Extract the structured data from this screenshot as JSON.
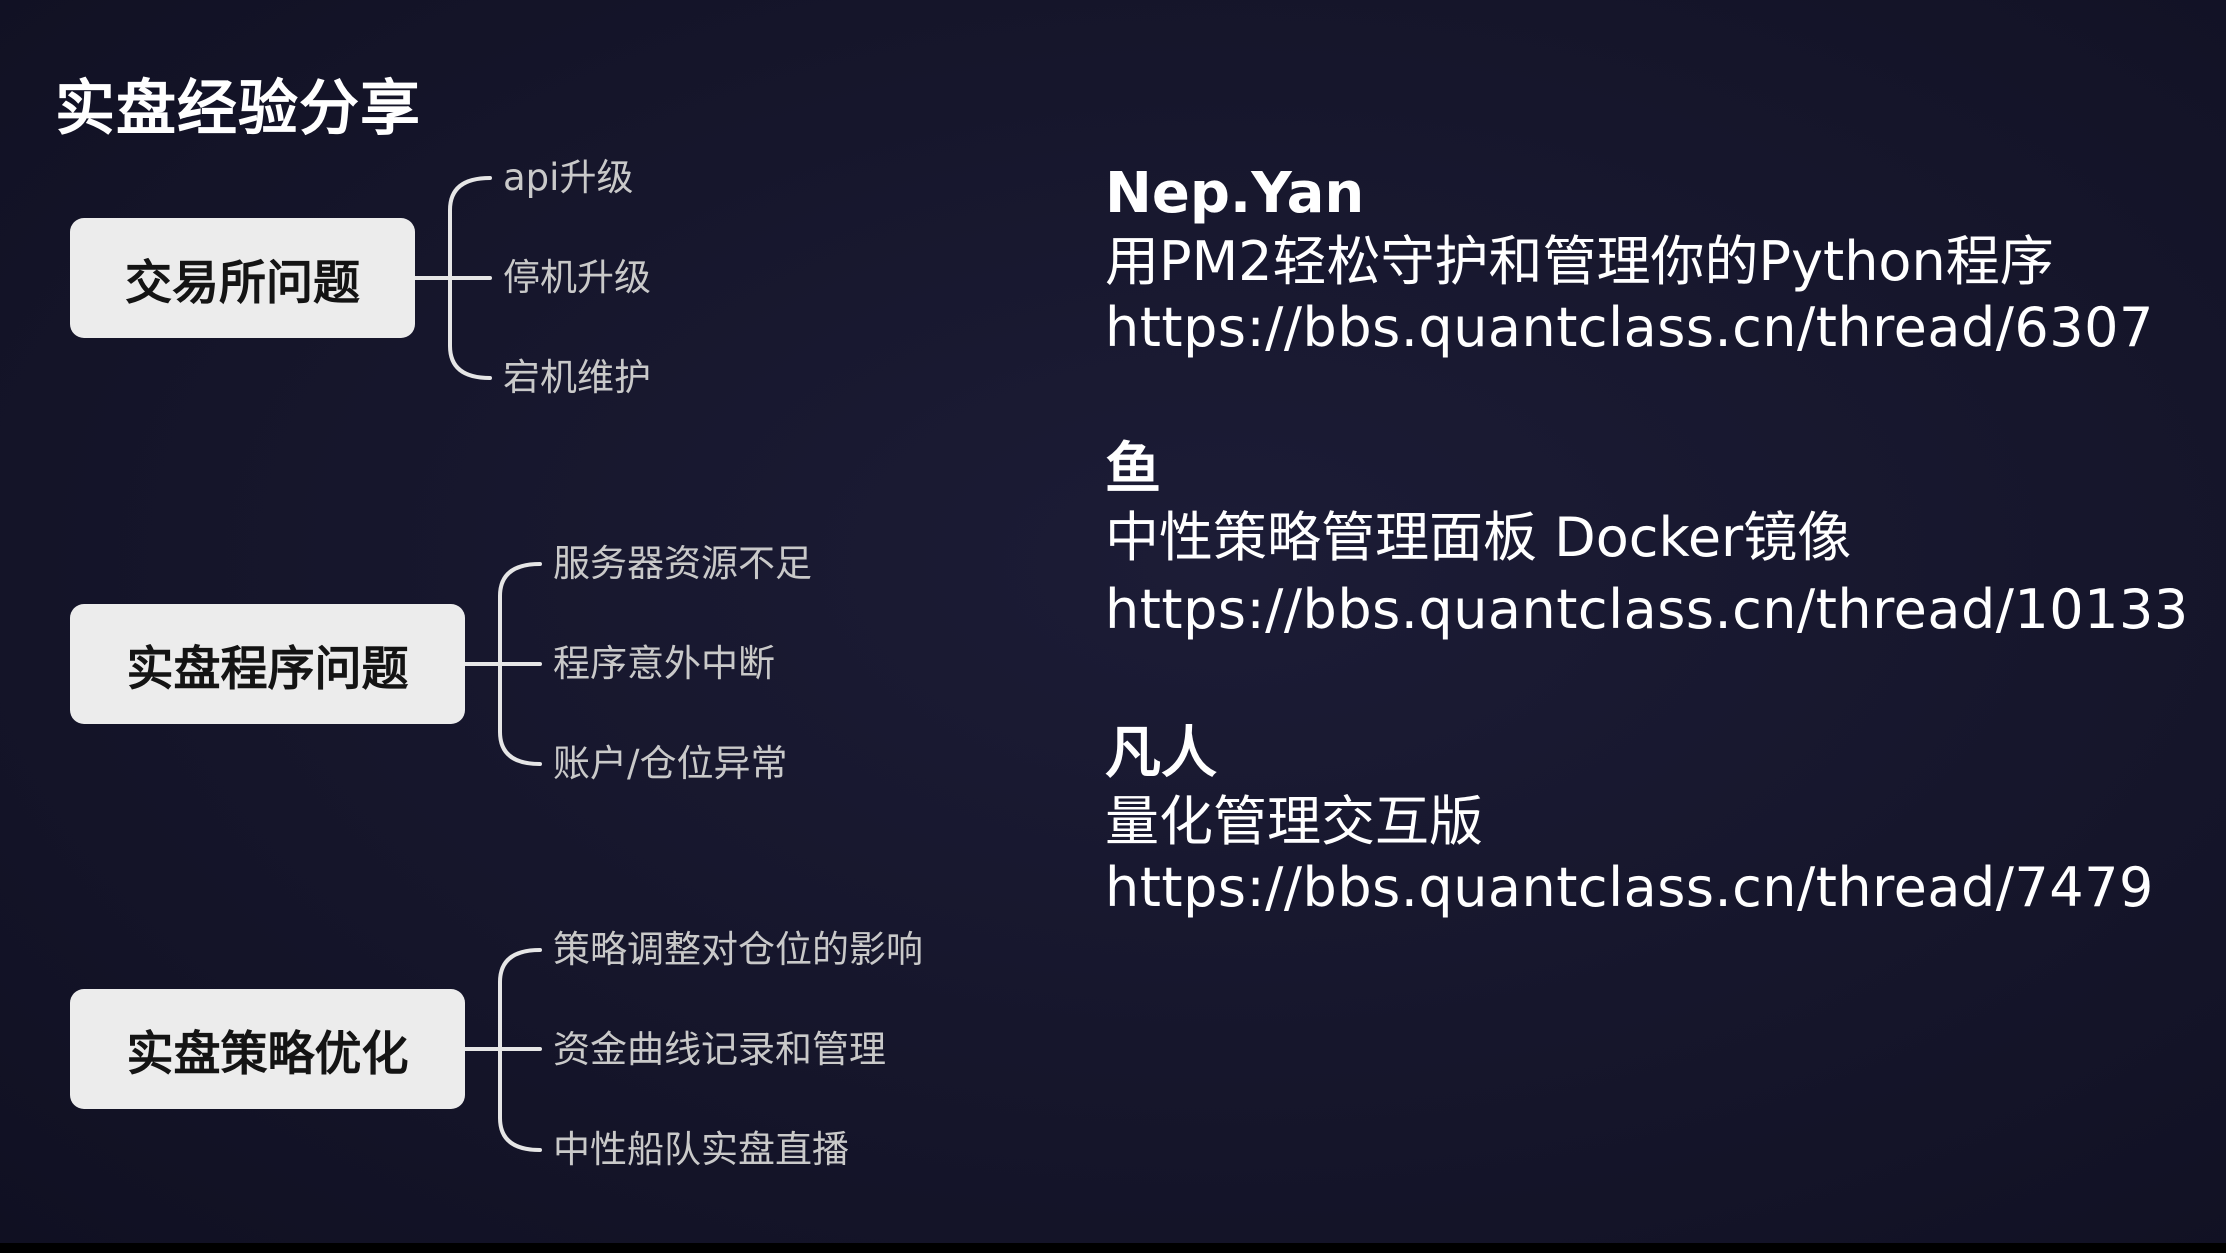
{
  "page_title": "实盘经验分享",
  "mindmap": {
    "groups": [
      {
        "label": "交易所问题",
        "items": [
          "api升级",
          "停机升级",
          "宕机维护"
        ]
      },
      {
        "label": "实盘程序问题",
        "items": [
          "服务器资源不足",
          "程序意外中断",
          "账户/仓位异常"
        ]
      },
      {
        "label": "实盘策略优化",
        "items": [
          "策略调整对仓位的影响",
          "资金曲线记录和管理",
          "中性船队实盘直播"
        ]
      }
    ]
  },
  "credits": [
    {
      "author": "Nep.Yan",
      "title": "用PM2轻松守护和管理你的Python程序",
      "link": "https://bbs.quantclass.cn/thread/6307"
    },
    {
      "author": "鱼",
      "title": "中性策略管理面板 Docker镜像",
      "link": "https://bbs.quantclass.cn/thread/10133"
    },
    {
      "author": "凡人",
      "title": "量化管理交互版",
      "link": "https://bbs.quantclass.cn/thread/7479"
    }
  ],
  "colors": {
    "background": "#16162a",
    "node_fill": "#ececec",
    "node_text": "#141414",
    "leaf_text": "#c9c9c9",
    "connector": "#e6e6e6",
    "text": "#ffffff"
  }
}
